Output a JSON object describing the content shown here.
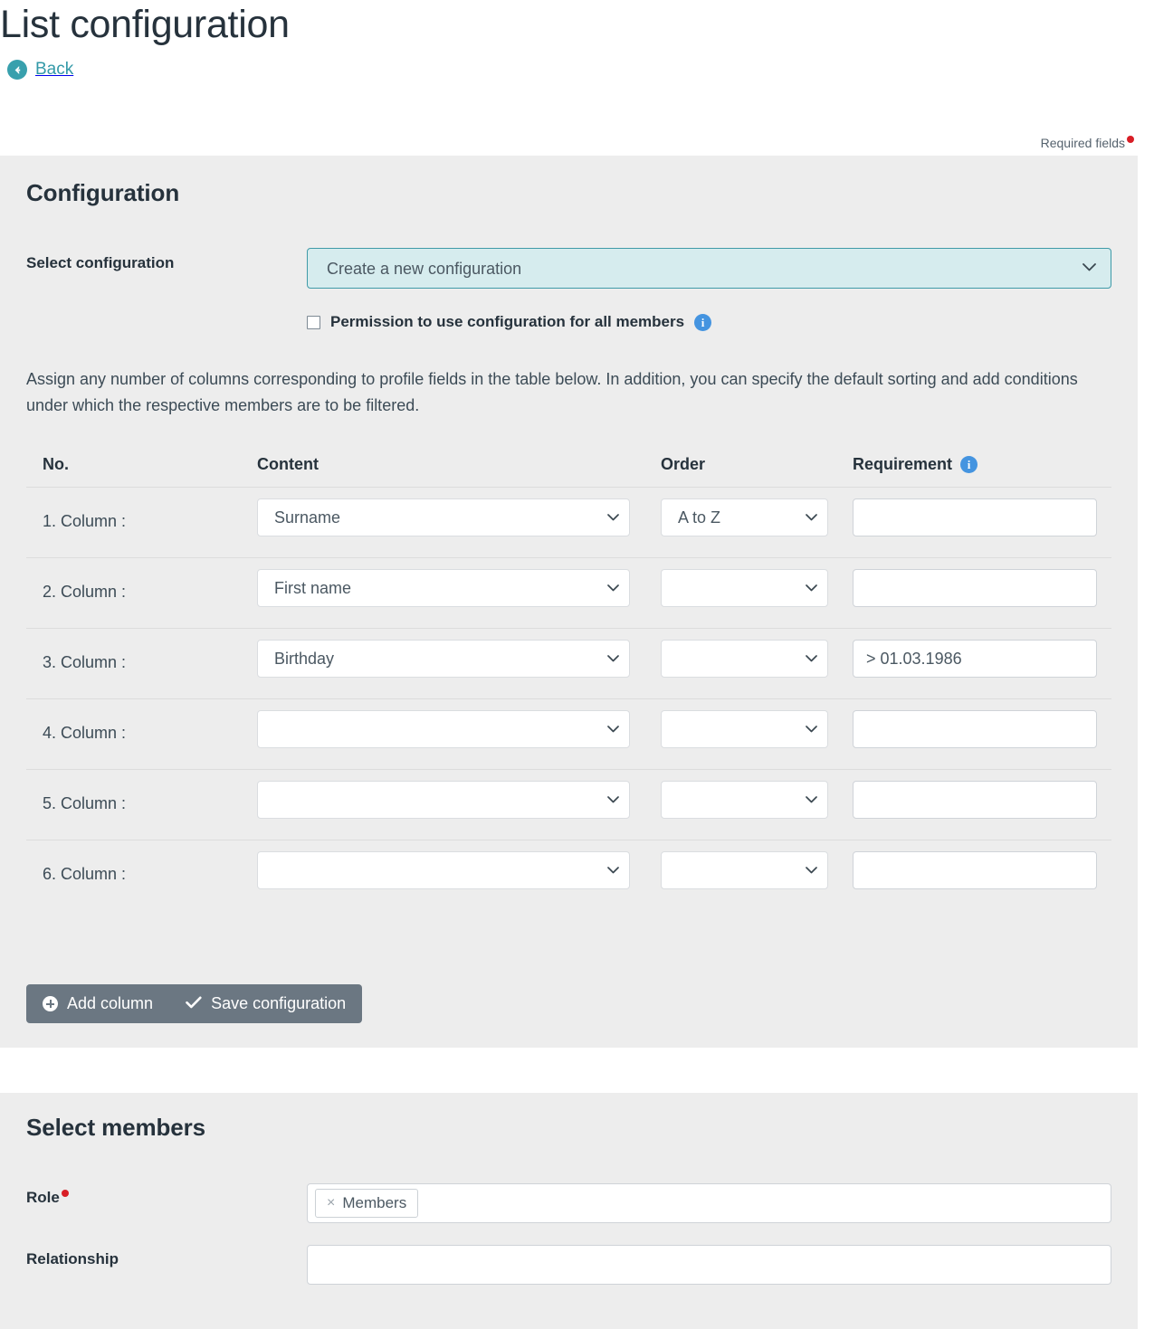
{
  "header": {
    "title": "List configuration",
    "back_label": "Back",
    "back_icon": "arrow-circle-left-icon",
    "required_fields_label": "Required fields"
  },
  "configuration": {
    "title": "Configuration",
    "select_configuration_label": "Select configuration",
    "select_configuration_value": "Create a new configuration",
    "select_configuration_options": [
      "Create a new configuration"
    ],
    "permission_checkbox_label": "Permission to use configuration for all members",
    "permission_checked": false,
    "permission_info_icon": "info-icon",
    "intro_text": "Assign any number of columns corresponding to profile fields in the table below. In addition, you can specify the default sorting and add conditions under which the respective members are to be filtered.",
    "table": {
      "headers": {
        "no": "No.",
        "content": "Content",
        "order": "Order",
        "requirement": "Requirement",
        "requirement_info_icon": "info-icon"
      },
      "rows": [
        {
          "no": "1. Column :",
          "content": "Surname",
          "order": "A to Z",
          "requirement": ""
        },
        {
          "no": "2. Column :",
          "content": "First name",
          "order": "",
          "requirement": ""
        },
        {
          "no": "3. Column :",
          "content": "Birthday",
          "order": "",
          "requirement": "> 01.03.1986"
        },
        {
          "no": "4. Column :",
          "content": "",
          "order": "",
          "requirement": ""
        },
        {
          "no": "5. Column :",
          "content": "",
          "order": "",
          "requirement": ""
        },
        {
          "no": "6. Column :",
          "content": "",
          "order": "",
          "requirement": ""
        }
      ]
    },
    "add_column_label": "Add column",
    "add_column_icon": "plus-circle-icon",
    "save_configuration_label": "Save configuration",
    "save_configuration_icon": "check-icon"
  },
  "members": {
    "title": "Select members",
    "role_label": "Role",
    "role_required": true,
    "role_tags": [
      "Members"
    ],
    "role_tag_remove_icon": "close-icon",
    "relationship_label": "Relationship",
    "relationship_value": ""
  },
  "colors": {
    "panel_background": "#ededed",
    "page_background": "#ffffff",
    "accent_teal": "#38a0ad",
    "info_blue": "#4494e0",
    "required_red": "#d81e26",
    "button_gray": "#6b7782",
    "select_highlight_fill": "#d6ecee",
    "select_highlight_border": "#3f9aa8",
    "heading_text": "#26323c"
  }
}
